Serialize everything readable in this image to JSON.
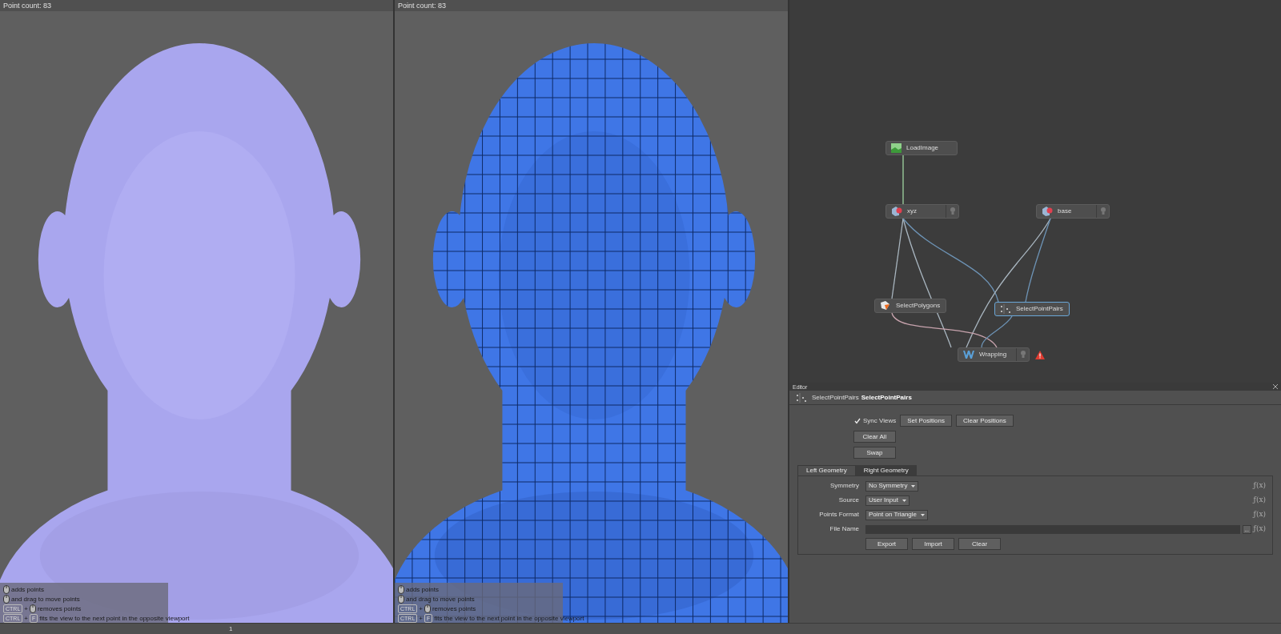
{
  "viewports": [
    {
      "point_count": "Point count: 83",
      "hints": [
        {
          "parts": [
            {
              "kind": "mouse"
            },
            {
              "kind": "text",
              "text": "adds points"
            }
          ]
        },
        {
          "parts": [
            {
              "kind": "mouse"
            },
            {
              "kind": "text",
              "text": "and drag to move points"
            }
          ]
        },
        {
          "parts": [
            {
              "kind": "key",
              "text": "CTRL"
            },
            {
              "kind": "text",
              "text": "+"
            },
            {
              "kind": "mouse"
            },
            {
              "kind": "text",
              "text": "removes points"
            }
          ]
        },
        {
          "parts": [
            {
              "kind": "key",
              "text": "CTRL"
            },
            {
              "kind": "text",
              "text": "+"
            },
            {
              "kind": "key",
              "text": "F"
            },
            {
              "kind": "text",
              "text": "fits the view to the next point in the opposite viewport"
            }
          ]
        }
      ]
    },
    {
      "point_count": "Point count: 83",
      "hints": [
        {
          "parts": [
            {
              "kind": "mouse"
            },
            {
              "kind": "text",
              "text": "adds points"
            }
          ]
        },
        {
          "parts": [
            {
              "kind": "mouse"
            },
            {
              "kind": "text",
              "text": "and drag to move points"
            }
          ]
        },
        {
          "parts": [
            {
              "kind": "key",
              "text": "CTRL"
            },
            {
              "kind": "text",
              "text": "+"
            },
            {
              "kind": "mouse"
            },
            {
              "kind": "text",
              "text": "removes points"
            }
          ]
        },
        {
          "parts": [
            {
              "kind": "key",
              "text": "CTRL"
            },
            {
              "kind": "text",
              "text": "+"
            },
            {
              "kind": "key",
              "text": "F"
            },
            {
              "kind": "text",
              "text": "fits the view to the next point in the opposite viewport"
            }
          ]
        }
      ]
    }
  ],
  "node_graph": {
    "nodes": [
      {
        "label": "LoadImage",
        "selected": false,
        "bulb": false,
        "warning": false
      },
      {
        "label": "xyz",
        "selected": false,
        "bulb": true,
        "warning": false
      },
      {
        "label": "base",
        "selected": false,
        "bulb": true,
        "warning": false
      },
      {
        "label": "SelectPolygons",
        "selected": false,
        "bulb": false,
        "warning": false
      },
      {
        "label": "SelectPointPairs",
        "selected": true,
        "bulb": false,
        "warning": false
      },
      {
        "label": "Wrapping",
        "selected": false,
        "bulb": true,
        "warning": true
      }
    ]
  },
  "editor": {
    "title": "Editor",
    "node_type": "SelectPointPairs",
    "node_name": "SelectPointPairs",
    "sync_views": {
      "label": "Sync Views",
      "checked": true
    },
    "row_buttons": [
      "Set Positions",
      "Clear Positions"
    ],
    "buttons": [
      "Clear All",
      "Swap"
    ],
    "tabs": [
      {
        "label": "Left Geometry",
        "selected": true
      },
      {
        "label": "Right Geometry",
        "selected": false
      }
    ],
    "fields": [
      {
        "label": "Symmetry",
        "kind": "dropdown",
        "value": "No Symmetry",
        "fx": "ƒ(x)"
      },
      {
        "label": "Source",
        "kind": "dropdown",
        "value": "User Input",
        "fx": "ƒ(x)"
      },
      {
        "label": "Points Format",
        "kind": "dropdown",
        "value": "Point on Triangle",
        "fx": "ƒ(x)"
      },
      {
        "label": "File Name",
        "kind": "file",
        "browse": "...",
        "fx": "ƒ(x)"
      }
    ],
    "bottom_buttons": [
      "Export",
      "Import",
      "Clear"
    ]
  },
  "status_bar": {
    "text": "1"
  }
}
